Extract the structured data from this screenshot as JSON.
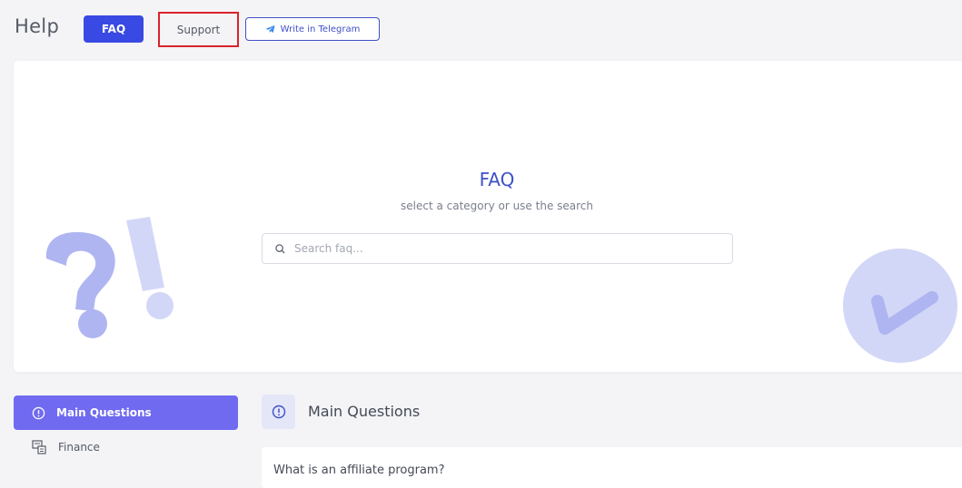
{
  "header": {
    "title": "Help",
    "tabs": {
      "faq": "FAQ",
      "support": "Support",
      "telegram": "Write in Telegram"
    }
  },
  "hero": {
    "title": "FAQ",
    "subtitle": "select a category or use the search",
    "search_placeholder": "Search faq..."
  },
  "sidebar": {
    "items": [
      {
        "label": "Main Questions",
        "icon": "info-circle-icon",
        "active": true
      },
      {
        "label": "Finance",
        "icon": "finance-icon",
        "active": false
      }
    ]
  },
  "main": {
    "section_title": "Main Questions",
    "questions": [
      {
        "text": "What is an affiliate program?"
      }
    ]
  },
  "colors": {
    "primary": "#3949e3",
    "accent_purple": "#6f6af0",
    "highlight_border": "#d9232a",
    "deco": "#c9cdf5"
  }
}
